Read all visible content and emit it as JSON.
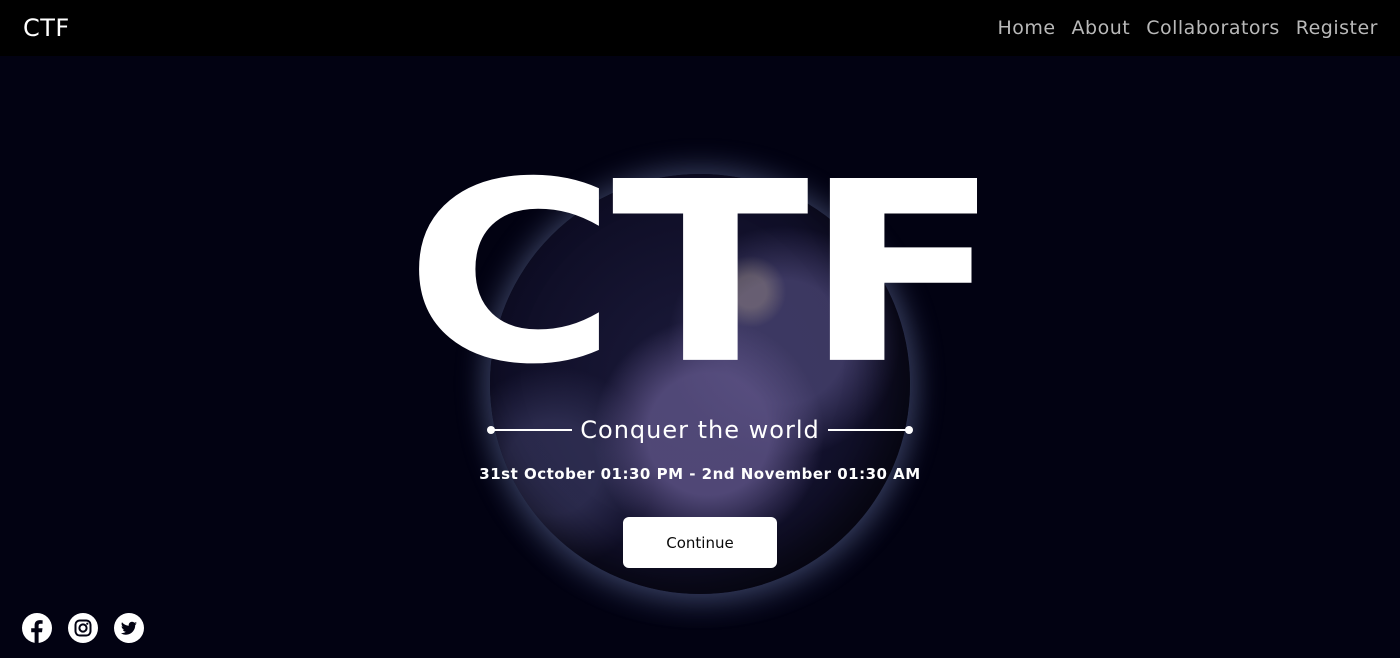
{
  "navbar": {
    "brand": "CTF",
    "links": [
      "Home",
      "About",
      "Collaborators",
      "Register"
    ]
  },
  "hero": {
    "title": "CTF",
    "tagline": "Conquer the world",
    "dates": "31st October 01:30 PM - 2nd November 01:30 AM",
    "button_label": "Continue"
  },
  "social": {
    "icons": [
      "facebook-icon",
      "instagram-icon",
      "twitter-icon"
    ]
  },
  "colors": {
    "background": "#020212",
    "navbar": "#000000",
    "nav_link": "#b9b9b9",
    "text": "#ffffff",
    "button_bg": "#ffffff",
    "button_text": "#0a0a0a"
  }
}
